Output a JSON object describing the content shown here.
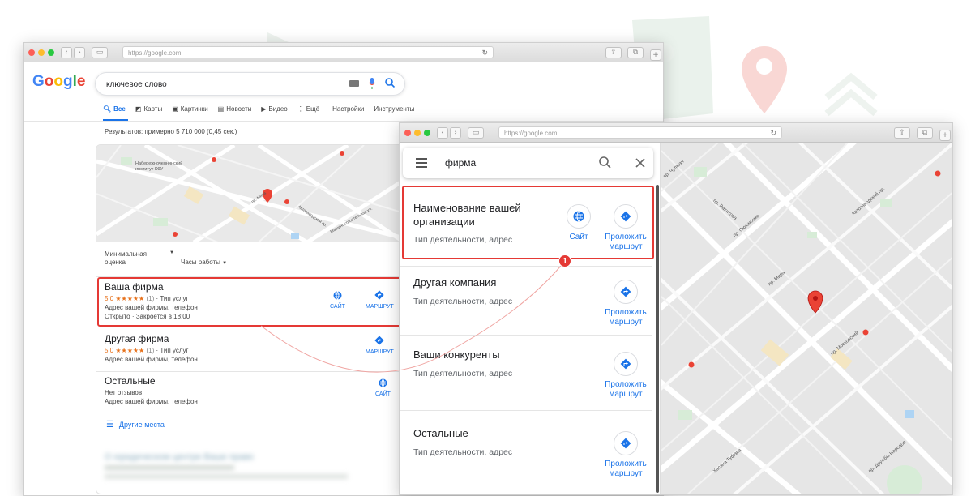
{
  "window1": {
    "url": "https://google.com",
    "search_query": "ключевое слово",
    "tabs": [
      {
        "label": "Все",
        "icon": "search-icon"
      },
      {
        "label": "Карты",
        "icon": "map-icon"
      },
      {
        "label": "Картинки",
        "icon": "image-icon"
      },
      {
        "label": "Новости",
        "icon": "news-icon"
      },
      {
        "label": "Видео",
        "icon": "video-icon"
      },
      {
        "label": "Ещё",
        "icon": "more-icon"
      },
      {
        "label": "Настройки",
        "icon": ""
      },
      {
        "label": "Инструменты",
        "icon": ""
      }
    ],
    "results_count": "Результатов: примерно 5 710 000 (0,45 сек.)",
    "map_labels": {
      "institute": "Набережночелнинский институт КФУ",
      "street1": "пр. Мира",
      "street2": "Автозаводский пр.",
      "street3": "пр. Московский",
      "street4": "Машиностроительная ул."
    },
    "filters": {
      "rating": "Минимальная оценка",
      "hours": "Часы работы"
    },
    "listings": [
      {
        "name": "Ваша фирма",
        "rating": "5,0",
        "stars": "★★★★★",
        "reviews": "(1)",
        "type": "· Тип услуг",
        "address": "Адрес вашей фирмы, телефон",
        "hours": "Открыто · Закроется в 18:00",
        "site_label": "САЙТ",
        "route_label": "МАРШРУТ"
      },
      {
        "name": "Другая фирма",
        "rating": "5,0",
        "stars": "★★★★★",
        "reviews": "(1)",
        "type": "· Тип услуг",
        "address": "Адрес вашей фирмы, телефон",
        "route_label": "МАРШРУТ"
      },
      {
        "name": "Остальные",
        "reviews_text": "Нет отзывов",
        "address": "Адрес вашей фирмы, телефон",
        "site_label": "САЙТ"
      }
    ],
    "more_places": "Другие места",
    "blurred_result": "О юридическом центре Ваше право"
  },
  "window2": {
    "url": "https://google.com",
    "search_query": "фирма",
    "listings": [
      {
        "name": "Наименование вашей организации",
        "desc": "Тип деятельности, адрес",
        "site_label": "Сайт",
        "route_label": "Проложить маршрут"
      },
      {
        "name": "Другая компания",
        "desc": "Тип деятельности, адрес",
        "route_label": "Проложить маршрут"
      },
      {
        "name": "Ваши конкуренты",
        "desc": "Тип деятельности, адрес",
        "route_label": "Проложить маршрут"
      },
      {
        "name": "Остальные",
        "desc": "Тип деятельности, адрес",
        "route_label": "Проложить маршрут"
      }
    ],
    "map_labels": {
      "a": "Автозаводский пр.",
      "b": "пр. Мира",
      "c": "пр. Московский",
      "d": "пр. Вахитова",
      "e": "пр. Сююмбике",
      "f": "пр. Чулман",
      "g": "Хасана Туфана",
      "h": "пр. Дружбы Народов"
    }
  },
  "callout_number": "1",
  "colors": {
    "accent": "#1a73e8",
    "highlight": "#e53935",
    "star": "#e7711b",
    "pin": "#ea4335"
  }
}
